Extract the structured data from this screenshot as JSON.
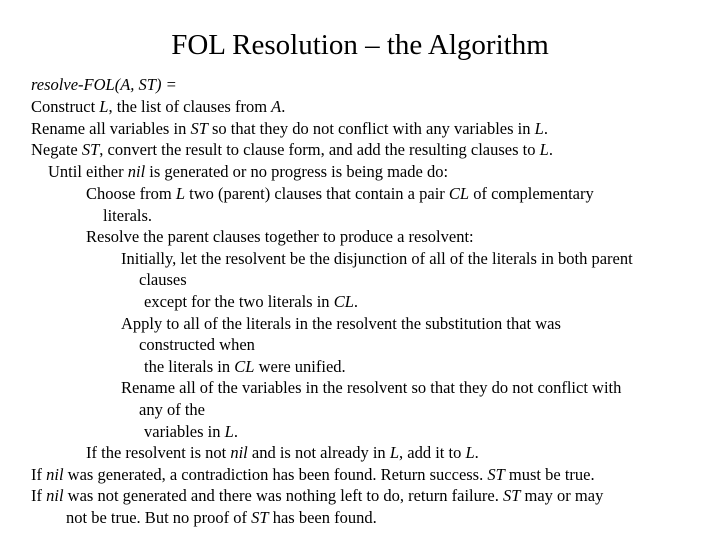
{
  "slide": {
    "title": "FOL Resolution – the Algorithm",
    "lines": [
      {
        "indent": 0,
        "segments": [
          {
            "t": "resolve-FOL(A, ST) =",
            "i": true
          }
        ]
      },
      {
        "indent": 0,
        "segments": [
          {
            "t": "Construct "
          },
          {
            "t": "L",
            "i": true
          },
          {
            "t": ", the list of clauses from "
          },
          {
            "t": "A",
            "i": true
          },
          {
            "t": "."
          }
        ]
      },
      {
        "indent": 0,
        "segments": [
          {
            "t": "Rename all variables in "
          },
          {
            "t": "ST",
            "i": true
          },
          {
            "t": " so that they do not conflict with any variables in "
          },
          {
            "t": "L",
            "i": true
          },
          {
            "t": "."
          }
        ]
      },
      {
        "indent": 0,
        "segments": [
          {
            "t": "Negate "
          },
          {
            "t": "ST",
            "i": true
          },
          {
            "t": ", convert the result to clause form, and add the resulting clauses to "
          },
          {
            "t": "L",
            "i": true
          },
          {
            "t": "."
          }
        ]
      },
      {
        "indent": 1,
        "segments": [
          {
            "t": "Until either "
          },
          {
            "t": "nil",
            "i": true
          },
          {
            "t": " is generated or no progress is being made do:"
          }
        ]
      },
      {
        "indent": 2,
        "segments": [
          {
            "t": "Choose from "
          },
          {
            "t": "L",
            "i": true
          },
          {
            "t": " two (parent) clauses that contain a pair "
          },
          {
            "t": "CL",
            "i": true
          },
          {
            "t": " of complementary"
          }
        ]
      },
      {
        "indent": 3,
        "segments": [
          {
            "t": "literals."
          }
        ]
      },
      {
        "indent": 2,
        "segments": [
          {
            "t": "Resolve the parent clauses together to produce a resolvent:"
          }
        ]
      },
      {
        "indent": 4,
        "segments": [
          {
            "t": "Initially, let the resolvent be the disjunction of all of the literals in both parent"
          }
        ]
      },
      {
        "indent": 5,
        "segments": [
          {
            "t": "clauses"
          }
        ]
      },
      {
        "indent": 6,
        "segments": [
          {
            "t": "except for the two literals in "
          },
          {
            "t": "CL",
            "i": true
          },
          {
            "t": "."
          }
        ]
      },
      {
        "indent": 4,
        "segments": [
          {
            "t": "Apply to all of the literals in the resolvent the substitution that was"
          }
        ]
      },
      {
        "indent": 5,
        "segments": [
          {
            "t": "constructed when"
          }
        ]
      },
      {
        "indent": 6,
        "segments": [
          {
            "t": "the literals in "
          },
          {
            "t": "CL",
            "i": true
          },
          {
            "t": " were unified."
          }
        ]
      },
      {
        "indent": 4,
        "segments": [
          {
            "t": "Rename all of the variables in the resolvent so that they do not conflict with"
          }
        ]
      },
      {
        "indent": 5,
        "segments": [
          {
            "t": "any of the"
          }
        ]
      },
      {
        "indent": 6,
        "segments": [
          {
            "t": "variables in "
          },
          {
            "t": "L",
            "i": true
          },
          {
            "t": "."
          }
        ]
      },
      {
        "indent": 2,
        "segments": [
          {
            "t": "If the resolvent is not "
          },
          {
            "t": "nil",
            "i": true
          },
          {
            "t": " and is not already in "
          },
          {
            "t": "L",
            "i": true
          },
          {
            "t": ", add it to "
          },
          {
            "t": "L",
            "i": true
          },
          {
            "t": "."
          }
        ]
      },
      {
        "indent": 0,
        "segments": [
          {
            "t": "If "
          },
          {
            "t": "nil",
            "i": true
          },
          {
            "t": " was generated, a contradiction has been found.  Return success.  "
          },
          {
            "t": "ST",
            "i": true
          },
          {
            "t": " must be true."
          }
        ]
      },
      {
        "indent": 0,
        "segments": [
          {
            "t": "If "
          },
          {
            "t": "nil",
            "i": true
          },
          {
            "t": " was not generated and there was nothing left to do, return failure.  "
          },
          {
            "t": "ST",
            "i": true
          },
          {
            "t": " may or may"
          }
        ]
      },
      {
        "indent": 7,
        "segments": [
          {
            "t": "not be true.  But no proof of "
          },
          {
            "t": "ST",
            "i": true
          },
          {
            "t": " has been found."
          }
        ]
      }
    ]
  }
}
